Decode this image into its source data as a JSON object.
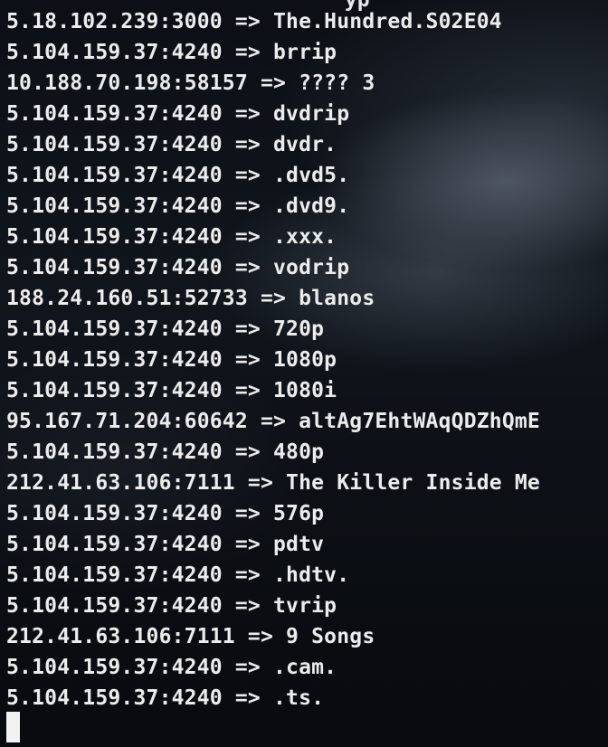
{
  "terminal": {
    "partial_top_line": "                           yp",
    "lines": [
      "5.18.102.239:3000 => The.Hundred.S02E04",
      "5.104.159.37:4240 => brrip",
      "10.188.70.198:58157 => ???? 3",
      "5.104.159.37:4240 => dvdrip",
      "5.104.159.37:4240 => dvdr.",
      "5.104.159.37:4240 => .dvd5.",
      "5.104.159.37:4240 => .dvd9.",
      "5.104.159.37:4240 => .xxx.",
      "5.104.159.37:4240 => vodrip",
      "188.24.160.51:52733 => blanos",
      "5.104.159.37:4240 => 720p",
      "5.104.159.37:4240 => 1080p",
      "5.104.159.37:4240 => 1080i",
      "95.167.71.204:60642 => altAg7EhtWAqQDZhQmE",
      "5.104.159.37:4240 => 480p",
      "212.41.63.106:7111 => The Killer Inside Me",
      "5.104.159.37:4240 => 576p",
      "5.104.159.37:4240 => pdtv",
      "5.104.159.37:4240 => .hdtv.",
      "5.104.159.37:4240 => tvrip",
      "212.41.63.106:7111 => 9 Songs",
      "5.104.159.37:4240 => .cam.",
      "5.104.159.37:4240 => .ts."
    ]
  },
  "colors": {
    "text": "#ececec",
    "cursor": "#f2f2f2",
    "background": "#0a0d12"
  }
}
